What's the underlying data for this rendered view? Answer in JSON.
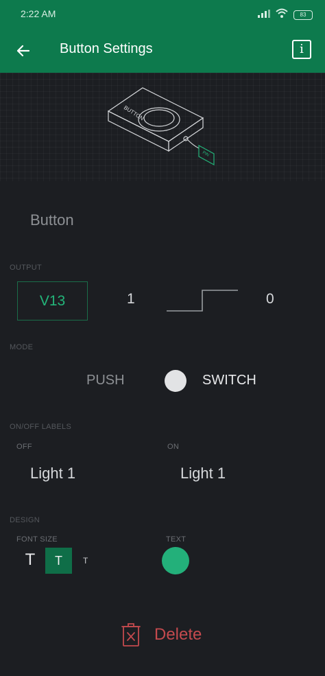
{
  "status_bar": {
    "time": "2:22 AM",
    "battery": "83"
  },
  "header": {
    "title": "Button Settings",
    "info_glyph": "i"
  },
  "hero": {
    "device_label": "BUTTON",
    "pin_label": "PIN"
  },
  "widget": {
    "name": "Button"
  },
  "output": {
    "section_label": "OUTPUT",
    "pin": "V13",
    "high_value": "1",
    "low_value": "0"
  },
  "mode": {
    "section_label": "MODE",
    "push_label": "PUSH",
    "switch_label": "SWITCH",
    "selected": "SWITCH"
  },
  "labels": {
    "section_label": "ON/OFF LABELS",
    "off_caption": "OFF",
    "on_caption": "ON",
    "off_value": "Light 1",
    "on_value": "Light 1"
  },
  "design": {
    "section_label": "DESIGN",
    "font_size_caption": "FONT SIZE",
    "text_caption": "TEXT",
    "font_glyph": "T",
    "selected_font_size": "medium",
    "text_color": "#23b07a"
  },
  "actions": {
    "delete_label": "Delete"
  },
  "colors": {
    "accent": "#0d7a4d",
    "danger": "#c44a4e",
    "background": "#1c1e22"
  }
}
